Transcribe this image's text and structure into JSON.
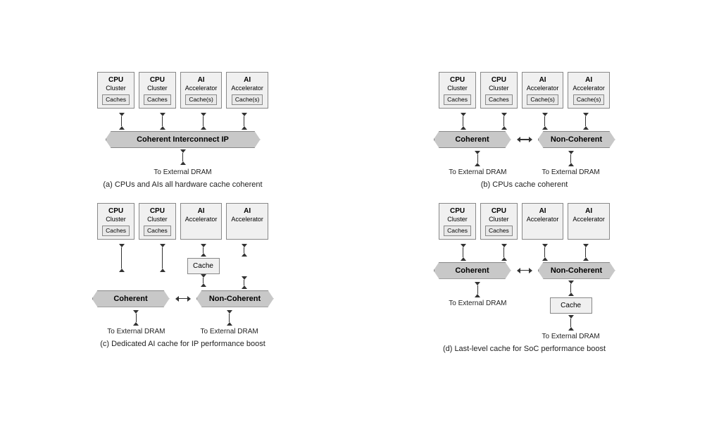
{
  "diagrams": {
    "a": {
      "caption": "(a) CPUs and AIs all hardware cache coherent",
      "units": [
        {
          "title": "CPU",
          "sub": "Cluster",
          "cache": "Caches"
        },
        {
          "title": "CPU",
          "sub": "Cluster",
          "cache": "Caches"
        },
        {
          "title": "AI",
          "sub": "Accelerator",
          "cache": "Cache(s)"
        },
        {
          "title": "AI",
          "sub": "Accelerator",
          "cache": "Cache(s)"
        }
      ],
      "banner": "Coherent Interconnect IP",
      "dram": "To External DRAM"
    },
    "b": {
      "caption": "(b) CPUs cache coherent",
      "units": [
        {
          "title": "CPU",
          "sub": "Cluster",
          "cache": "Caches"
        },
        {
          "title": "CPU",
          "sub": "Cluster",
          "cache": "Caches"
        },
        {
          "title": "AI",
          "sub": "Accelerator",
          "cache": "Cache(s)"
        },
        {
          "title": "AI",
          "sub": "Accelerator",
          "cache": "Cache(s)"
        }
      ],
      "banner_left": "Coherent",
      "banner_right": "Non-Coherent",
      "dram_left": "To External DRAM",
      "dram_right": "To External DRAM"
    },
    "c": {
      "caption": "(c) Dedicated AI cache for IP performance boost",
      "units": [
        {
          "title": "CPU",
          "sub": "Cluster",
          "cache": "Caches"
        },
        {
          "title": "CPU",
          "sub": "Cluster",
          "cache": "Caches"
        },
        {
          "title": "AI",
          "sub": "Accelerator",
          "cache": ""
        },
        {
          "title": "AI",
          "sub": "Accelerator",
          "cache": ""
        }
      ],
      "mid_cache": "Cache",
      "banner_left": "Coherent",
      "banner_right": "Non-Coherent",
      "dram_left": "To External DRAM",
      "dram_right": "To External DRAM"
    },
    "d": {
      "caption": "(d) Last-level cache for SoC performance boost",
      "units": [
        {
          "title": "CPU",
          "sub": "Cluster",
          "cache": "Caches"
        },
        {
          "title": "CPU",
          "sub": "Cluster",
          "cache": "Caches"
        },
        {
          "title": "AI",
          "sub": "Accelerator",
          "cache": ""
        },
        {
          "title": "AI",
          "sub": "Accelerator",
          "cache": ""
        }
      ],
      "banner_left": "Coherent",
      "banner_right": "Non-Coherent",
      "mid_cache": "Cache",
      "dram_left": "To External DRAM",
      "dram_right": "To External DRAM"
    }
  }
}
